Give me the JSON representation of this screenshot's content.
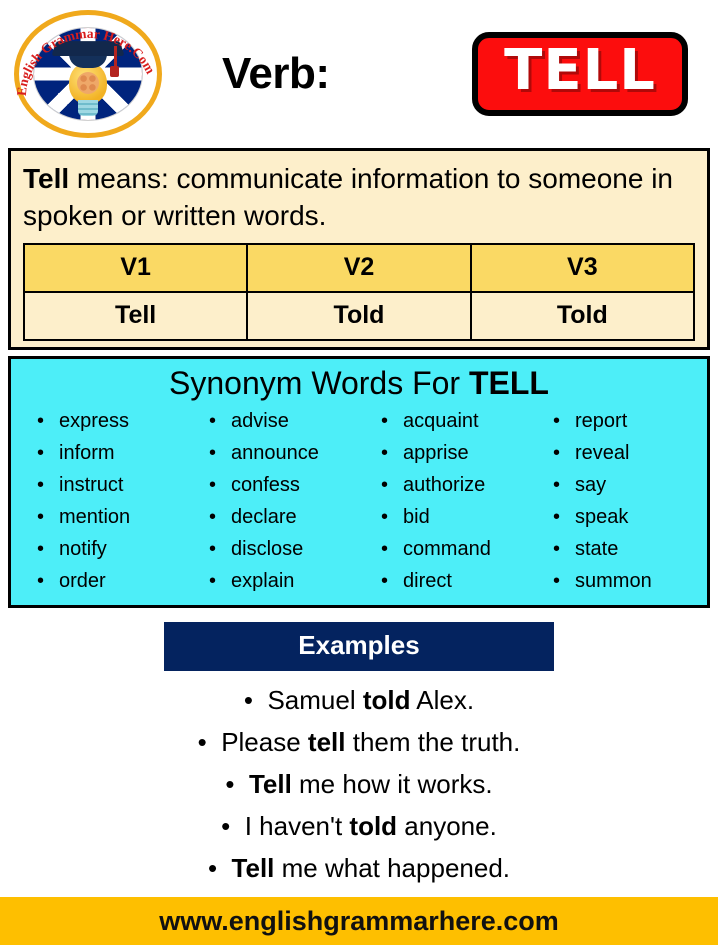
{
  "header": {
    "logo": {
      "name": "english-grammar-here-logo",
      "arc_text_top": "English Grammar",
      "arc_text_bottom": "Here.Com",
      "full_text": "English Grammar Here.Com"
    },
    "verb_label": "Verb:",
    "word": "TELL"
  },
  "definition": {
    "term": "Tell",
    "lead": " means: communicate information to someone in spoken or written words."
  },
  "forms": {
    "headers": [
      "V1",
      "V2",
      "V3"
    ],
    "values": [
      "Tell",
      "Told",
      "Told"
    ]
  },
  "synonyms": {
    "title_prefix": "Synonym Words For ",
    "title_word": "TELL",
    "columns": [
      [
        "express",
        "inform",
        "instruct",
        "mention",
        "notify",
        "order"
      ],
      [
        "advise",
        "announce",
        "confess",
        "declare",
        "disclose",
        "explain"
      ],
      [
        "acquaint",
        "apprise",
        "authorize",
        "bid",
        "command",
        "direct"
      ],
      [
        "report",
        "reveal",
        "say",
        "speak",
        "state",
        "summon"
      ]
    ]
  },
  "examples": {
    "banner_label": "Examples",
    "items": [
      {
        "before": "Samuel ",
        "bold": "told",
        "after": " Alex."
      },
      {
        "before": "Please ",
        "bold": "tell",
        "after": " them the truth."
      },
      {
        "before": "",
        "bold": "Tell",
        "after": " me how it works."
      },
      {
        "before": "I haven't ",
        "bold": "told",
        "after": " anyone."
      },
      {
        "before": "",
        "bold": "Tell",
        "after": " me what happened."
      }
    ]
  },
  "footer": {
    "url": "www.englishgrammarhere.com"
  },
  "colors": {
    "badge_red": "#FC0D0D",
    "panel_cream": "#FDEFCB",
    "table_header_gold": "#FAD964",
    "synonym_cyan": "#4DEEF8",
    "examples_navy": "#04235F",
    "footer_amber": "#FEBF00",
    "logo_ring_gold": "#F0A91C"
  }
}
